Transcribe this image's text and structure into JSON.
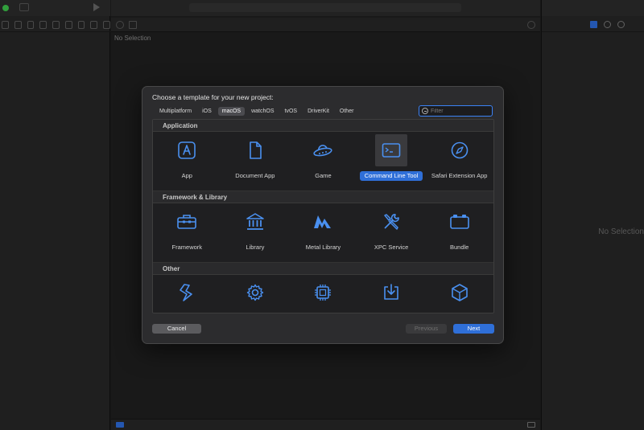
{
  "window": {
    "left_status": "",
    "center_no_selection": "No Selection",
    "right_no_selection": "No Selection"
  },
  "sheet": {
    "title": "Choose a template for your new project:",
    "tabs": [
      "Multiplatform",
      "iOS",
      "macOS",
      "watchOS",
      "tvOS",
      "DriverKit",
      "Other"
    ],
    "active_tab": "macOS",
    "filter_placeholder": "Filter",
    "sections": [
      {
        "header": "Application",
        "items": [
          {
            "label": "App",
            "icon": "app-store-a-icon"
          },
          {
            "label": "Document App",
            "icon": "document-icon"
          },
          {
            "label": "Game",
            "icon": "ufo-icon"
          },
          {
            "label": "Command Line Tool",
            "icon": "terminal-icon",
            "selected": true
          },
          {
            "label": "Safari Extension App",
            "icon": "compass-icon"
          }
        ]
      },
      {
        "header": "Framework & Library",
        "items": [
          {
            "label": "Framework",
            "icon": "toolbox-icon"
          },
          {
            "label": "Library",
            "icon": "building-columns-icon"
          },
          {
            "label": "Metal Library",
            "icon": "metal-icon"
          },
          {
            "label": "XPC Service",
            "icon": "wrench-screwdriver-icon"
          },
          {
            "label": "Bundle",
            "icon": "bundle-icon"
          }
        ]
      },
      {
        "header": "Other",
        "items": [
          {
            "label": "",
            "icon": "swift-package-icon"
          },
          {
            "label": "",
            "icon": "gear-icon"
          },
          {
            "label": "",
            "icon": "chip-icon"
          },
          {
            "label": "",
            "icon": "download-tray-icon"
          },
          {
            "label": "",
            "icon": "cube-icon"
          }
        ]
      }
    ],
    "buttons": {
      "cancel": "Cancel",
      "previous": "Previous",
      "next": "Next"
    }
  },
  "colors": {
    "accent": "#2f6fd8",
    "icon_blue": "#4a90f0",
    "sheet_bg": "#2c2c2e"
  }
}
